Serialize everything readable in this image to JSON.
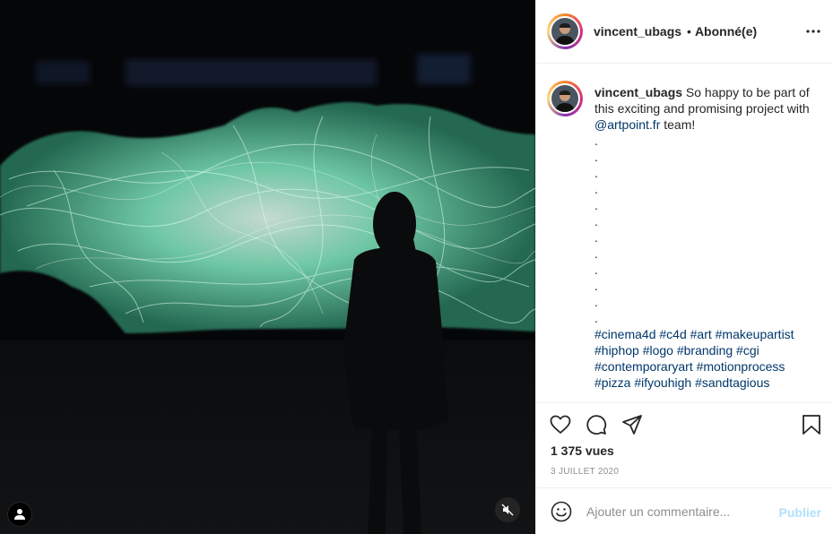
{
  "post": {
    "username": "vincent_ubags",
    "separator": "•",
    "follow_status": "Abonné(e)",
    "caption": {
      "username": "vincent_ubags",
      "text_before": " So happy to be part of this exciting and promising project with ",
      "mention": "@artpoint.fr",
      "text_after": " team!",
      "dots": [
        ".",
        ".",
        ".",
        ".",
        ".",
        ".",
        ".",
        ".",
        ".",
        ".",
        ".",
        "."
      ],
      "hashtags_line1": "#cinema4d #c4d #art #makeupartist",
      "hashtags_line2": "#hiphop #logo #branding #cgi",
      "hashtags_line3": "#contemporaryart #motionprocess",
      "hashtags_line4": "#pizza #ifyouhigh #sandtagious"
    },
    "views": "1 375 vues",
    "date": "3 JUILLET 2020"
  },
  "comment": {
    "placeholder": "Ajouter un commentaire...",
    "post_label": "Publier"
  },
  "colors": {
    "link": "#00376b",
    "publish_disabled": "#b2dffc",
    "avatar_ring": [
      "#f58529",
      "#dd2a7b",
      "#8134af"
    ],
    "glow": "#6fe3b0"
  },
  "icons": [
    "tag-user-icon",
    "volume-muted-icon",
    "more-options-icon",
    "heart-icon",
    "comment-icon",
    "share-icon",
    "bookmark-icon",
    "emoji-icon"
  ]
}
